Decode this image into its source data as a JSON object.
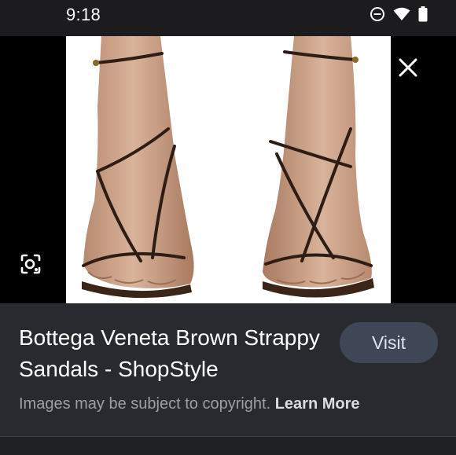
{
  "status_bar": {
    "time": "9:18",
    "icons": [
      "do-not-disturb-icon",
      "wifi-icon",
      "battery-icon"
    ]
  },
  "viewer": {
    "image_alt": "Bottega Veneta Brown Strappy Sandals",
    "close_icon": "close-icon",
    "lens_icon": "lens-icon"
  },
  "info": {
    "title": "Bottega Veneta Brown Strappy Sandals - ShopStyle",
    "visit_label": "Visit",
    "copyright_text": "Images may be subject to copyright.",
    "learn_more_label": "Learn More"
  },
  "colors": {
    "background": "#202124",
    "panel": "#282a2f",
    "visit_button": "#3f4757",
    "visit_text": "#dbe3f6",
    "muted_text": "#9aa0a6"
  }
}
